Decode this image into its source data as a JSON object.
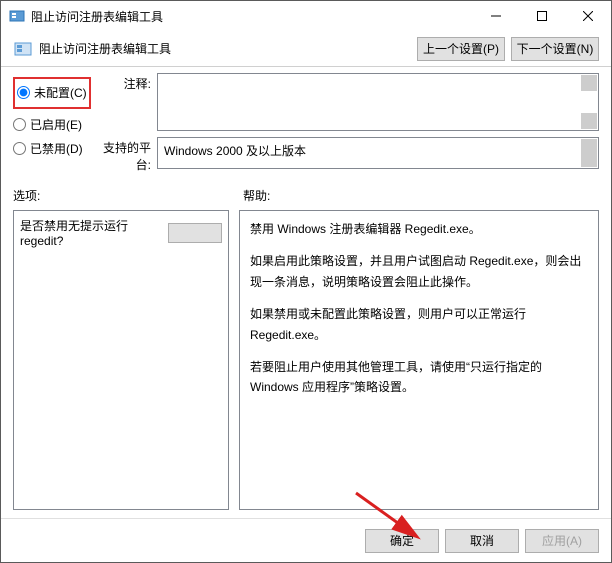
{
  "titlebar": {
    "title": "阻止访问注册表编辑工具"
  },
  "subheader": {
    "title": "阻止访问注册表编辑工具",
    "prev_btn": "上一个设置(P)",
    "next_btn": "下一个设置(N)"
  },
  "radios": {
    "not_configured": "未配置(C)",
    "enabled": "已启用(E)",
    "disabled": "已禁用(D)"
  },
  "fields": {
    "comment_label": "注释:",
    "comment_value": "",
    "platform_label": "支持的平台:",
    "platform_value": "Windows 2000 及以上版本"
  },
  "columns": {
    "options_label": "选项:",
    "help_label": "帮助:"
  },
  "options": {
    "prompt_text": "是否禁用无提示运行 regedit?"
  },
  "help": {
    "p1": "禁用 Windows 注册表编辑器 Regedit.exe。",
    "p2": "如果启用此策略设置，并且用户试图启动 Regedit.exe，则会出现一条消息，说明策略设置会阻止此操作。",
    "p3": "如果禁用或未配置此策略设置，则用户可以正常运行 Regedit.exe。",
    "p4": "若要阻止用户使用其他管理工具，请使用“只运行指定的 Windows 应用程序”策略设置。"
  },
  "footer": {
    "ok": "确定",
    "cancel": "取消",
    "apply": "应用(A)"
  }
}
